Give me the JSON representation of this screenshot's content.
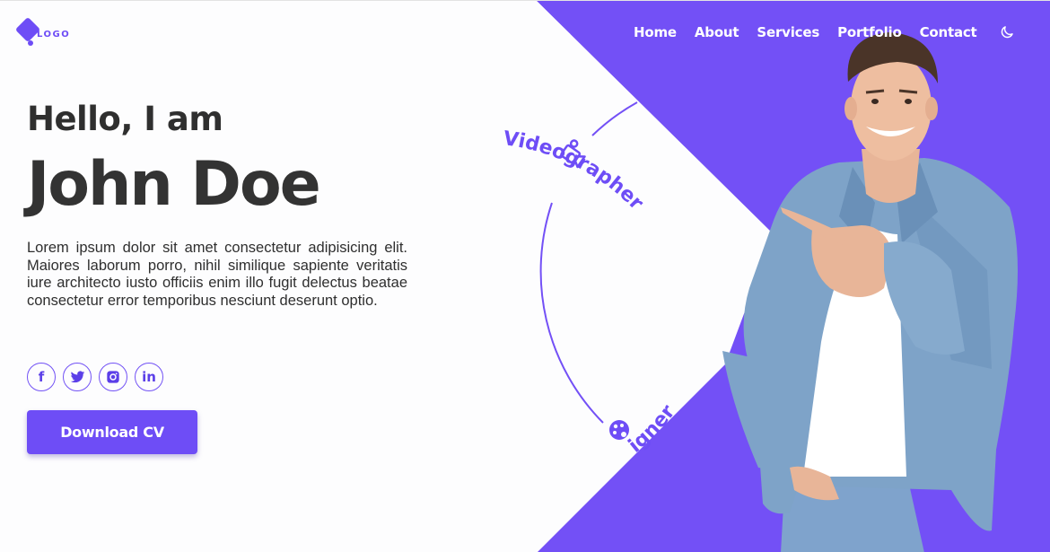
{
  "logo": {
    "text": "LOGO"
  },
  "nav": {
    "items": [
      "Home",
      "About",
      "Services",
      "Portfolio",
      "Contact"
    ],
    "theme_icon": "moon-icon"
  },
  "hero": {
    "greeting": "Hello, I am",
    "name": "John Doe",
    "bio": "Lorem ipsum dolor sit amet consectetur adipisicing elit. Maiores laborum porro, nihil similique sapiente veritatis iure architecto iusto officiis enim illo fugit delectus beatae consectetur error temporibus nesciunt deserunt optio.",
    "cta_label": "Download CV"
  },
  "socials": [
    {
      "name": "facebook",
      "glyph": "f"
    },
    {
      "name": "twitter",
      "glyph": ""
    },
    {
      "name": "instagram",
      "glyph": ""
    },
    {
      "name": "linkedin",
      "glyph": "in"
    }
  ],
  "roles": {
    "primary": "Videographer",
    "secondary": "igner"
  },
  "colors": {
    "accent": "#6e4df6",
    "text": "#2f2f2f",
    "background": "#fdfdfe",
    "nav_text": "#ffffff"
  }
}
